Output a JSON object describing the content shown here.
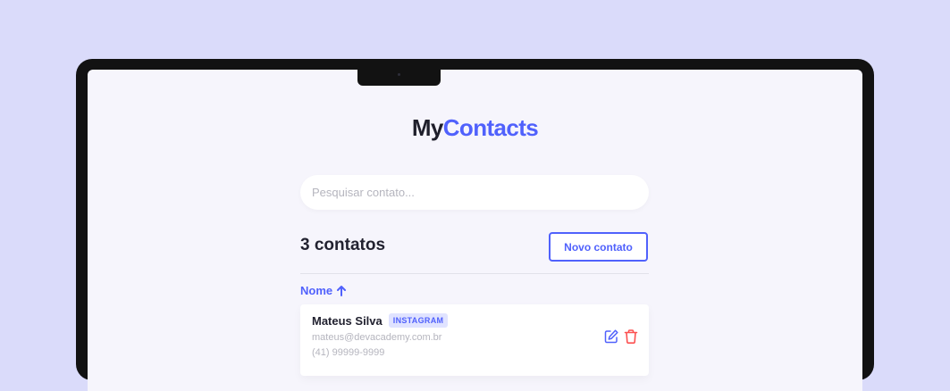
{
  "app": {
    "logo_part1": "My",
    "logo_part2": "Contacts"
  },
  "search": {
    "placeholder": "Pesquisar contato...",
    "value": ""
  },
  "header": {
    "count_label": "3 contatos",
    "new_button_label": "Novo contato"
  },
  "sort": {
    "label": "Nome",
    "direction_icon": "arrow-up-icon"
  },
  "contacts": [
    {
      "name": "Mateus Silva",
      "category": "INSTAGRAM",
      "email": "mateus@devacademy.com.br",
      "phone": "(41) 99999-9999"
    }
  ],
  "colors": {
    "background": "#dadbfa",
    "primary": "#5061fc",
    "danger": "#fc5050",
    "text": "#222230",
    "muted": "#b5b5be"
  }
}
